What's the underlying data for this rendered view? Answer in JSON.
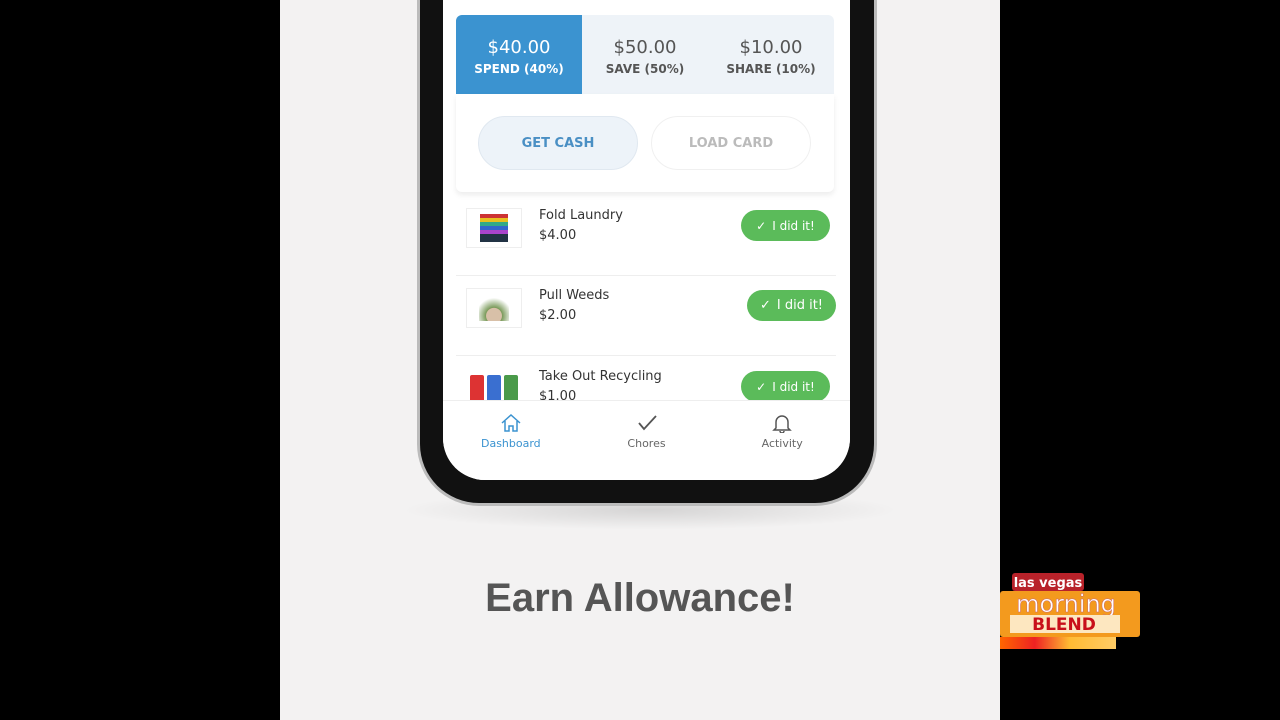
{
  "balances": [
    {
      "amount": "$40.00",
      "label": "SPEND (40%)",
      "selected": true
    },
    {
      "amount": "$50.00",
      "label": "SAVE (50%)",
      "selected": false
    },
    {
      "amount": "$10.00",
      "label": "SHARE (10%)",
      "selected": false
    }
  ],
  "actions": {
    "get_cash": "GET CASH",
    "load_card": "LOAD CARD"
  },
  "chores": [
    {
      "name": "Fold Laundry",
      "price": "$4.00",
      "button": "I did it!"
    },
    {
      "name": "Pull Weeds",
      "price": "$2.00",
      "button": "I did it!"
    },
    {
      "name": "Take Out Recycling",
      "price": "$1.00",
      "button": "I did it!"
    }
  ],
  "nav": [
    {
      "label": "Dashboard",
      "icon": "home-icon",
      "active": true
    },
    {
      "label": "Chores",
      "icon": "check-icon"
    },
    {
      "label": "Activity",
      "icon": "bell-icon"
    }
  ],
  "caption": "Earn Allowance!",
  "logo": {
    "line1": "las vegas",
    "line2": "morning",
    "line3": "BLEND"
  },
  "colors": {
    "accent": "#3b93d0",
    "success": "#5bbb5a"
  }
}
